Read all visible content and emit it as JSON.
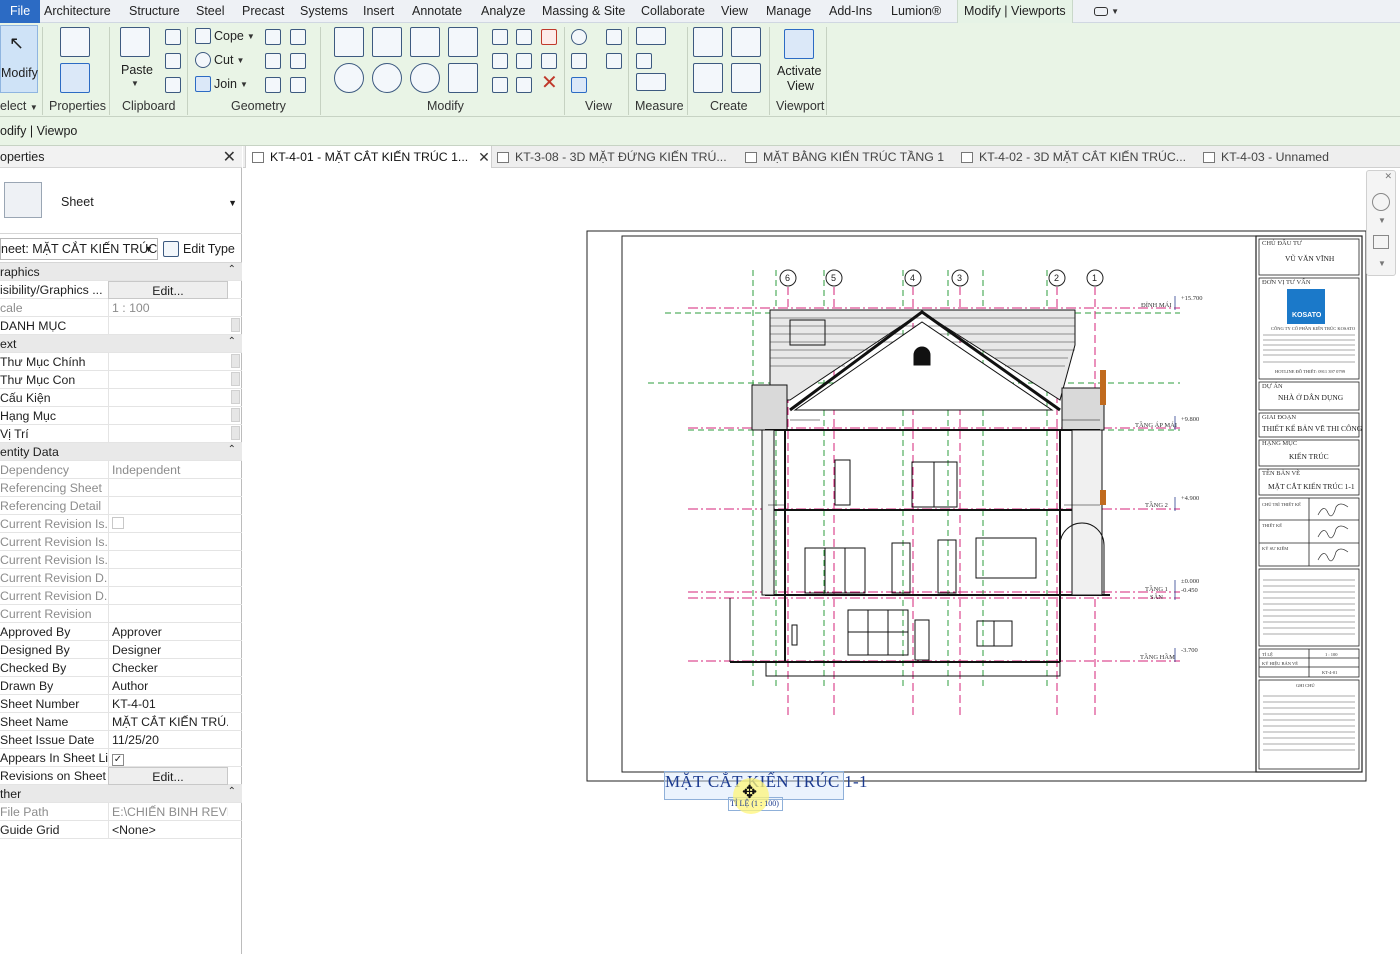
{
  "menu": {
    "file": "File",
    "tabs": [
      "Architecture",
      "Structure",
      "Steel",
      "Precast",
      "Systems",
      "Insert",
      "Annotate",
      "Analyze",
      "Massing & Site",
      "Collaborate",
      "View",
      "Manage",
      "Add-Ins",
      "Lumion®"
    ],
    "active_tab": "Modify | Viewports"
  },
  "ribbon": {
    "select": {
      "modify_label": "Modify",
      "select_label": "elect"
    },
    "properties_label": "Properties",
    "clipboard": {
      "paste_label": "Paste",
      "panel_label": "Clipboard"
    },
    "geometry": {
      "cope_label": "Cope",
      "cut_label": "Cut",
      "join_label": "Join",
      "panel_label": "Geometry"
    },
    "modify_panel_label": "Modify",
    "view_panel_label": "View",
    "measure_panel_label": "Measure",
    "create_panel_label": "Create",
    "viewport": {
      "activate_label_1": "Activate",
      "activate_label_2": "View",
      "panel_label": "Viewport"
    }
  },
  "options_bar": {
    "context_label": "odify | Viewpo"
  },
  "properties": {
    "header": "operties",
    "type_name": "Sheet",
    "instance_selector": "neet: MẶT CẮT KIẾN TRÚC",
    "edit_type_label": "Edit Type",
    "rows": [
      {
        "kind": "group",
        "label": "raphics"
      },
      {
        "label": "isibility/Graphics ...",
        "value": "Edit...",
        "button": true
      },
      {
        "label": "cale",
        "value": "1 : 100",
        "grey": true
      },
      {
        "label": "DANH MỤC",
        "value": ""
      },
      {
        "kind": "group",
        "label": "ext"
      },
      {
        "label": "Thư Mục Chính",
        "value": ""
      },
      {
        "label": "Thư Mục Con",
        "value": ""
      },
      {
        "label": "Cấu Kiện",
        "value": ""
      },
      {
        "label": "Hạng Mục",
        "value": ""
      },
      {
        "label": "Vị Trí",
        "value": ""
      },
      {
        "kind": "group",
        "label": "entity Data"
      },
      {
        "label": "Dependency",
        "value": "Independent",
        "grey": true
      },
      {
        "label": "Referencing Sheet",
        "value": "",
        "grey": true
      },
      {
        "label": "Referencing Detail",
        "value": "",
        "grey": true
      },
      {
        "label": "Current Revision Is...",
        "value": "",
        "grey": true,
        "checkbox": "off"
      },
      {
        "label": "Current Revision Is...",
        "value": "",
        "grey": true
      },
      {
        "label": "Current Revision Is...",
        "value": "",
        "grey": true
      },
      {
        "label": "Current Revision D...",
        "value": "",
        "grey": true
      },
      {
        "label": "Current Revision D...",
        "value": "",
        "grey": true
      },
      {
        "label": "Current Revision",
        "value": "",
        "grey": true
      },
      {
        "label": "Approved By",
        "value": "Approver"
      },
      {
        "label": "Designed By",
        "value": "Designer"
      },
      {
        "label": "Checked By",
        "value": "Checker"
      },
      {
        "label": "Drawn By",
        "value": "Author"
      },
      {
        "label": "Sheet Number",
        "value": "KT-4-01"
      },
      {
        "label": "Sheet Name",
        "value": "MẶT CẮT KIẾN TRÚ..."
      },
      {
        "label": "Sheet Issue Date",
        "value": "11/25/20"
      },
      {
        "label": "Appears In Sheet List",
        "value": "",
        "checkbox": "on"
      },
      {
        "label": "Revisions on Sheet",
        "value": "Edit...",
        "button": true
      },
      {
        "kind": "group",
        "label": "ther"
      },
      {
        "label": "File Path",
        "value": "E:\\CHIẾN BINH REVI...",
        "grey": true
      },
      {
        "label": "Guide Grid",
        "value": "<None>"
      }
    ]
  },
  "view_tabs": [
    {
      "label": "KT-4-01 - MẶT CẮT KIẾN TRÚC 1...",
      "active": true
    },
    {
      "label": "KT-3-08 - 3D MẶT ĐỨNG KIẾN TRÚ..."
    },
    {
      "label": "MẶT BẰNG KIẾN TRÚC TẦNG 1"
    },
    {
      "label": "KT-4-02 - 3D MẶT CẮT KIẾN TRÚC..."
    },
    {
      "label": "KT-4-03 - Unnamed"
    }
  ],
  "sheet": {
    "view_title": "MẶT CẮT KIẾN TRÚC 1-1",
    "view_scale": "TỈ LỆ (1 : 100)",
    "grid_bubbles": [
      "6",
      "5",
      "4",
      "3",
      "2",
      "1"
    ],
    "levels": [
      {
        "name": "ĐỈNH MÁI",
        "elev": "+15.700"
      },
      {
        "name": "TẦNG ÁP MÁI",
        "elev": "+9.800"
      },
      {
        "name": "TẦNG 2",
        "elev": "+4.900"
      },
      {
        "name": "TẦNG 1",
        "elev": "±0.000"
      },
      {
        "name": "SÂN",
        "elev": "-0.450"
      },
      {
        "name": "TẦNG HẦM",
        "elev": "-3.700"
      }
    ],
    "title_block": {
      "owner_label": "CHỦ ĐẦU TƯ",
      "owner": "VŨ VĂN VĨNH",
      "company_label": "ĐƠN VỊ TƯ VẤN",
      "company_logo": "KOSATO",
      "company_name": "CÔNG TY CỔ PHẦN KIẾN TRÚC KOSATO",
      "hotline": "HOTLINE ĐỒ THIẾT: 0911 397 0799",
      "project_label": "DỰ ÁN",
      "project": "NHÀ Ở DÂN DỤNG",
      "phase_label": "GIAI ĐOẠN",
      "phase": "THIẾT KẾ BẢN VẼ THI CÔNG",
      "category_label": "HẠNG MỤC",
      "category": "KIẾN TRÚC",
      "drawing_label": "TÊN BẢN VẼ",
      "drawing": "MẶT CẮT KIẾN TRÚC 1-1",
      "chief_label": "CHỦ TRÌ THIẾT KẾ",
      "designer_label": "THIẾT KẾ",
      "checker_label": "KỸ SƯ KIỂM",
      "scale_label": "TỈ LỆ",
      "scale": "1 : 100",
      "sheet_no_label": "KÝ HIỆU BẢN VẼ",
      "sheet_no": "KT-4-01",
      "notes_label": "GHI CHÚ"
    }
  },
  "colors": {
    "accent": "#2c6bc4",
    "ribbon_bg": "#e9f4e6",
    "grid_line": "#d4237a",
    "level_line": "#2e9e3c",
    "title_blue": "#1b3a8f"
  }
}
